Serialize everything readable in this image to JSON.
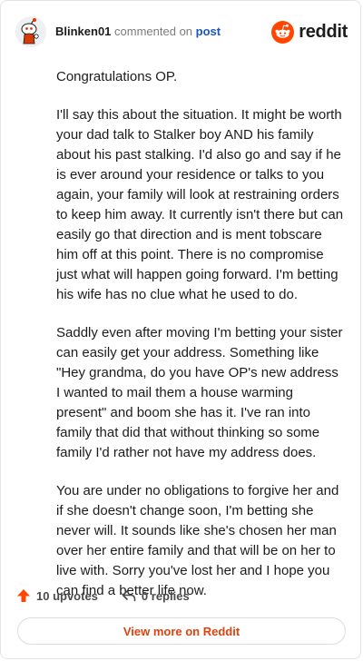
{
  "comment": {
    "author": "Blinken01",
    "action_text": "commented on",
    "post_link": "post",
    "avatar_icon": "snoo-avatar-icon",
    "paragraphs": [
      "Congratulations OP.",
      "I'll say this about the situation. It might be worth your dad talk to Stalker boy AND his family about his past stalking. I'd also go and say if he is ever around your residence or talks to you again, your family will look at restraining orders to keep him away. It currently isn't there but can easily go that direction and is ment tobscare him off at this point. There is no compromise just what will happen going forward. I'm betting his wife has no clue what he used to do.",
      "Saddly even after moving I'm betting your sister can easily get your address. Something like \"Hey grandma, do you have OP's new address I wanted to mail them a house warming present\" and boom she has it. I've ran into family that did that without thinking so some family I'd rather not have my address does.",
      "You are under no obligations to forgive her and if she doesn't change soon, I'm betting she never will. It sounds like she's chosen her man over her entire family and that will be on her to live with. Sorry you've lost her and I hope you can find a better life now."
    ]
  },
  "brand": {
    "name": "reddit",
    "logo_icon": "reddit-logo-icon",
    "accent": "#ff4500"
  },
  "actions": {
    "upvotes": "10 upvotes",
    "upvote_icon": "upvote-arrow-icon",
    "replies": "0 replies",
    "reply_icon": "reply-arrow-icon"
  },
  "footer": {
    "view_more": "View more on Reddit"
  },
  "colors": {
    "link": "#1a55c2",
    "view_more_text": "#e0410d",
    "upvote": "#ff4500"
  }
}
